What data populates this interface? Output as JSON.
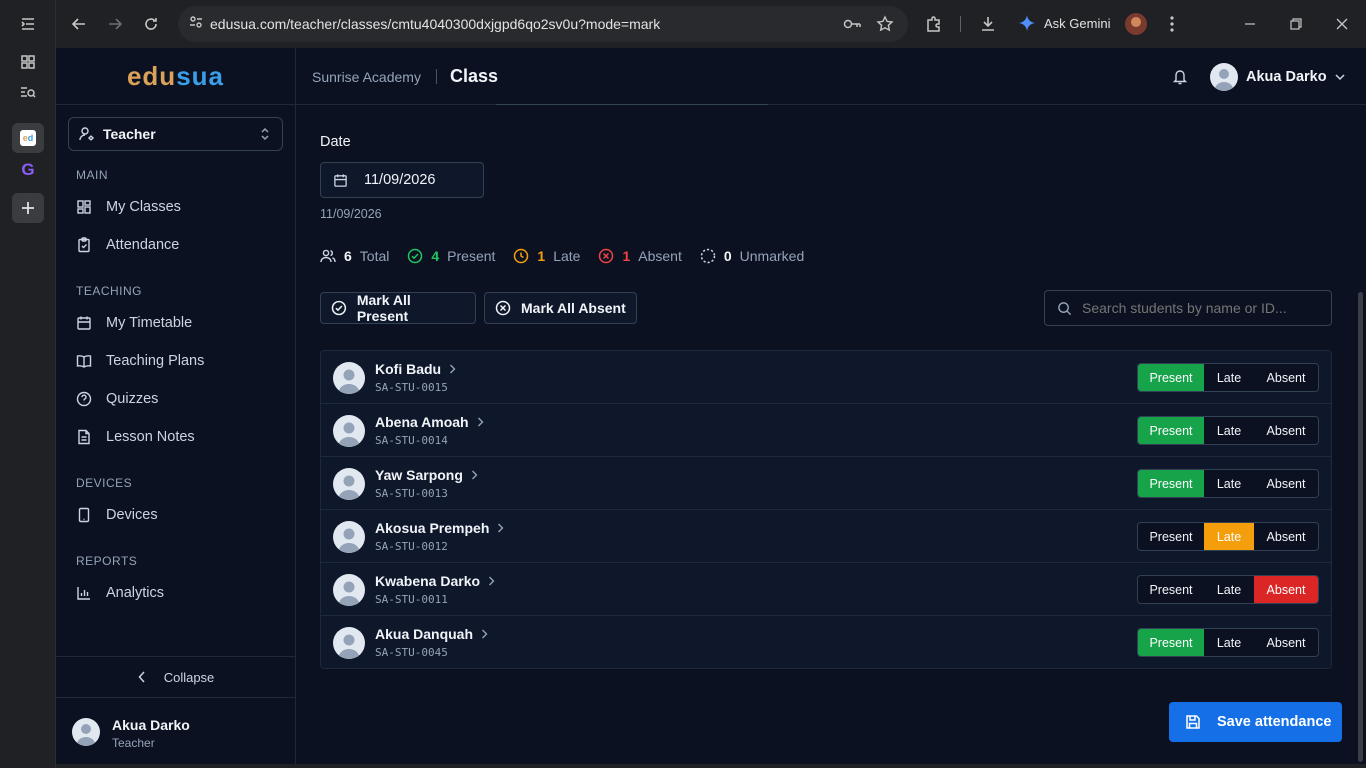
{
  "browser": {
    "url": "edusua.com/teacher/classes/cmtu4040300dxjgpd6qo2sv0u?mode=mark",
    "gemini_label": "Ask Gemini"
  },
  "sidebar": {
    "logo_part1": "edu",
    "logo_part2": "sua",
    "role": "Teacher",
    "sections": {
      "main": "MAIN",
      "teaching": "TEACHING",
      "devices": "DEVICES",
      "reports": "REPORTS"
    },
    "items": {
      "my_classes": "My Classes",
      "attendance": "Attendance",
      "my_timetable": "My Timetable",
      "teaching_plans": "Teaching Plans",
      "quizzes": "Quizzes",
      "lesson_notes": "Lesson Notes",
      "devices": "Devices",
      "analytics": "Analytics"
    },
    "collapse_label": "Collapse",
    "user_name": "Akua Darko",
    "user_role": "Teacher"
  },
  "header": {
    "school": "Sunrise Academy",
    "title": "Class",
    "user_name": "Akua Darko"
  },
  "attendance": {
    "date_label": "Date",
    "date_value": "11/09/2026",
    "date_caption": "11/09/2026",
    "stats": {
      "total_count": "6",
      "total_label": "Total",
      "present_count": "4",
      "present_label": "Present",
      "late_count": "1",
      "late_label": "Late",
      "absent_count": "1",
      "absent_label": "Absent",
      "unmarked_count": "0",
      "unmarked_label": "Unmarked"
    },
    "mark_all_present": "Mark All Present",
    "mark_all_absent": "Mark All Absent",
    "search_placeholder": "Search students by name or ID...",
    "status_labels": {
      "present": "Present",
      "late": "Late",
      "absent": "Absent"
    },
    "students": [
      {
        "name": "Kofi Badu",
        "id": "SA-STU-0015",
        "status": "present"
      },
      {
        "name": "Abena Amoah",
        "id": "SA-STU-0014",
        "status": "present"
      },
      {
        "name": "Yaw Sarpong",
        "id": "SA-STU-0013",
        "status": "present"
      },
      {
        "name": "Akosua Prempeh",
        "id": "SA-STU-0012",
        "status": "late"
      },
      {
        "name": "Kwabena Darko",
        "id": "SA-STU-0011",
        "status": "absent"
      },
      {
        "name": "Akua Danquah",
        "id": "SA-STU-0045",
        "status": "present"
      }
    ],
    "save_label": "Save attendance"
  },
  "colors": {
    "present": "#16a34a",
    "late": "#f59e0b",
    "absent": "#dc2626",
    "accent": "#1570e8"
  }
}
